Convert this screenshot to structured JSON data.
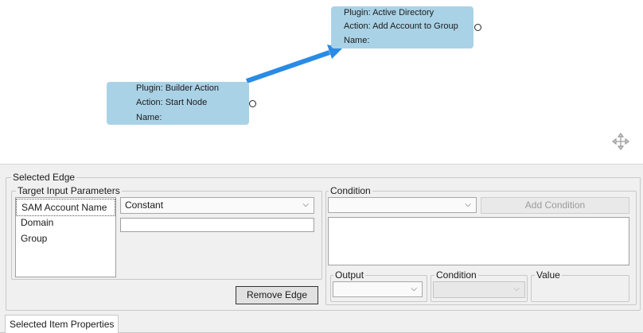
{
  "canvas": {
    "nodes": [
      {
        "plugin_label": "Plugin:",
        "plugin": "Active Directory",
        "action_label": "Action:",
        "action": "Add Account to Group",
        "name_label": "Name:"
      },
      {
        "plugin_label": "Plugin:",
        "plugin": "Builder Action",
        "action_label": "Action:",
        "action": "Start Node",
        "name_label": "Name:"
      }
    ],
    "edge_color": "#2a8be6",
    "node_color": "#aad2e6"
  },
  "selected_edge": {
    "title": "Selected Edge",
    "target_input": {
      "title": "Target Input Parameters",
      "params": [
        "SAM Account Name",
        "Domain",
        "Group"
      ],
      "source_type": "Constant",
      "value": ""
    },
    "condition": {
      "title": "Condition",
      "selected": "",
      "add_button": "Add Condition",
      "output_label": "Output",
      "condition_label": "Condition",
      "value_label": "Value"
    },
    "remove_button": "Remove Edge"
  },
  "bottom_tab": "Selected Item Properties"
}
